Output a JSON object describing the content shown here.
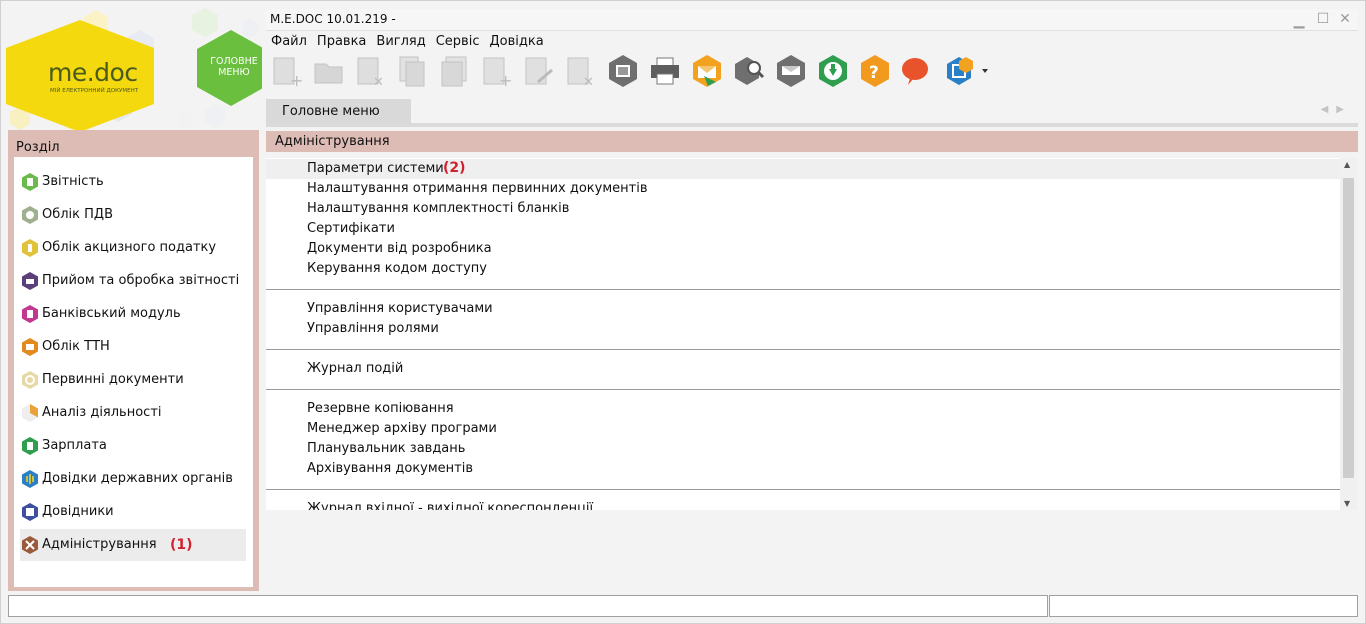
{
  "window": {
    "title": "M.E.DOC 10.01.219  -"
  },
  "logo": {
    "brand": "me.doc",
    "tagline": "МІЙ ЕЛЕКТРОННИЙ ДОКУМЕНТ",
    "home_button_label": "ГОЛОВНЕ МЕНЮ"
  },
  "menubar": {
    "items": [
      "Файл",
      "Правка",
      "Вигляд",
      "Сервіс",
      "Довідка"
    ]
  },
  "toolbar": {
    "buttons": [
      "new-document-icon",
      "open-folder-icon",
      "delete-document-icon",
      "copy-document-icon",
      "documents-stack-icon",
      "add-row-icon",
      "edit-row-icon",
      "delete-row-icon",
      "image-hex-icon",
      "printer-icon",
      "send-envelope-icon",
      "search-hex-icon",
      "receive-tray-icon",
      "download-green-icon",
      "help-orange-icon",
      "chat-bubble-icon",
      "video-help-icon"
    ]
  },
  "tabs": [
    {
      "label": "Головне меню"
    }
  ],
  "left_panel": {
    "header": "Розділ",
    "items": [
      {
        "label": "Звітність",
        "icon": "reports-icon",
        "color": "#6cba4c"
      },
      {
        "label": "Облік ПДВ",
        "icon": "vat-icon",
        "color": "#9fb08f"
      },
      {
        "label": "Облік акцизного податку",
        "icon": "excise-icon",
        "color": "#e3c23b"
      },
      {
        "label": "Прийом та обробка звітності",
        "icon": "reception-icon",
        "color": "#5b3f7a"
      },
      {
        "label": "Банківський модуль",
        "icon": "bank-icon",
        "color": "#c2378f"
      },
      {
        "label": "Облік ТТН",
        "icon": "waybill-icon",
        "color": "#e28a1e"
      },
      {
        "label": "Первинні документи",
        "icon": "primary-docs-icon",
        "color": "#e8d8a6"
      },
      {
        "label": "Аналіз діяльності",
        "icon": "analysis-icon",
        "color": "#e9a33a"
      },
      {
        "label": "Зарплата",
        "icon": "salary-icon",
        "color": "#2f9e4f"
      },
      {
        "label": "Довідки державних органів",
        "icon": "gov-references-icon",
        "color": "#2b7fc6"
      },
      {
        "label": "Довідники",
        "icon": "directories-icon",
        "color": "#3e4fa0"
      },
      {
        "label": "Адміністрування",
        "icon": "administration-icon",
        "color": "#9a5a3c"
      }
    ],
    "annotation": "(1)"
  },
  "section": {
    "title": "Адміністрування"
  },
  "content": {
    "groups": [
      {
        "items": [
          "Параметри системи",
          "Налаштування отримання первинних документів",
          "Налаштування комплектності бланків",
          "Сертифікати",
          "Документи від розробника",
          "Керування кодом доступу"
        ]
      },
      {
        "items": [
          "Управління користувачами",
          "Управління ролями"
        ]
      },
      {
        "items": [
          "Журнал подій"
        ]
      },
      {
        "items": [
          "Резервне копіювання",
          "Менеджер архіву програми",
          "Планувальник завдань",
          "Архівування документів"
        ]
      },
      {
        "items": [
          "Журнал вхідної - вихідної кореспонденції"
        ]
      }
    ],
    "annotation": "(2)"
  },
  "colors": {
    "panel_header": "#ddbcb6",
    "annotation": "#d0212f",
    "logo_yellow": "#f4d90f",
    "home_green": "#6abf3e"
  }
}
